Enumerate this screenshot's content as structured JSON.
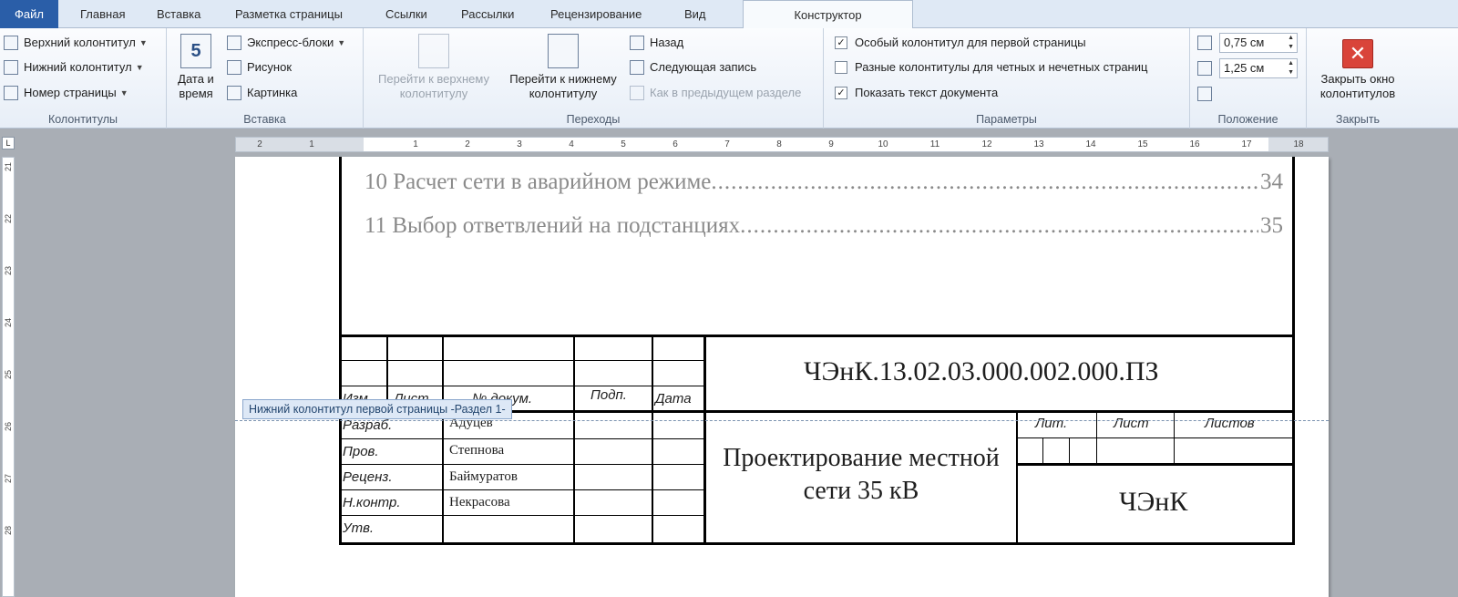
{
  "tabs": [
    {
      "label": "Файл"
    },
    {
      "label": "Главная"
    },
    {
      "label": "Вставка"
    },
    {
      "label": "Разметка страницы"
    },
    {
      "label": "Ссылки"
    },
    {
      "label": "Рассылки"
    },
    {
      "label": "Рецензирование"
    },
    {
      "label": "Вид"
    },
    {
      "label": "Конструктор"
    }
  ],
  "ribbon": {
    "headers_footers": {
      "label": "Колонтитулы",
      "header": "Верхний колонтитул",
      "footer": "Нижний колонтитул",
      "page_number": "Номер страницы"
    },
    "insert": {
      "label": "Вставка",
      "date_time": "Дата и время",
      "quick_parts": "Экспресс-блоки",
      "picture": "Рисунок",
      "clip_art": "Картинка"
    },
    "navigation": {
      "label": "Переходы",
      "go_to_header": "Перейти к верхнему колонтитулу",
      "go_to_footer": "Перейти к нижнему колонтитулу",
      "previous": "Назад",
      "next": "Следующая запись",
      "link_to_previous": "Как в предыдущем разделе"
    },
    "options": {
      "label": "Параметры",
      "different_first_page": "Особый колонтитул для первой страницы",
      "different_first_page_checked": true,
      "different_odd_even": "Разные колонтитулы для четных и нечетных страниц",
      "different_odd_even_checked": false,
      "show_document_text": "Показать текст документа",
      "show_document_text_checked": true
    },
    "position": {
      "label": "Положение",
      "header_from_top": "0,75 см",
      "footer_from_bottom": "1,25 см"
    },
    "close": {
      "label": "Закрыть",
      "close_button": "Закрыть окно колонтитулов"
    }
  },
  "ruler": {
    "corner": "L",
    "horizontal_numbers": [
      "2",
      "1",
      "1",
      "2",
      "3",
      "4",
      "5",
      "6",
      "7",
      "8",
      "9",
      "10",
      "11",
      "12",
      "13",
      "14",
      "15",
      "16",
      "17",
      "18"
    ],
    "vertical_numbers": [
      "21",
      "22",
      "23",
      "24",
      "25",
      "26",
      "27",
      "28"
    ]
  },
  "document": {
    "toc": [
      {
        "text": "10 Расчет сети в аварийном режиме",
        "page": "34"
      },
      {
        "text": "11 Выбор ответвлений на подстанциях",
        "page": "35"
      }
    ],
    "footer_tag": "Нижний колонтитул первой страницы -Раздел 1-",
    "stamp": {
      "headers": {
        "izm": "Изм.",
        "list": "Лист",
        "doc_no": "№ докум.",
        "sign": "Подп.",
        "date": "Дата"
      },
      "roles": [
        "Разраб.",
        "Пров.",
        "Реценз.",
        "Н.контр.",
        "Утв."
      ],
      "names": [
        "Адуцев",
        "Степнова",
        "Баймуратов",
        "Некрасова"
      ],
      "doc_code": "ЧЭнК.13.02.03.000.002.000.ПЗ",
      "title": "Проектирование местной сети 35 кВ",
      "lit": "Лит.",
      "sheet": "Лист",
      "sheets": "Листов",
      "org": "ЧЭнК"
    }
  }
}
